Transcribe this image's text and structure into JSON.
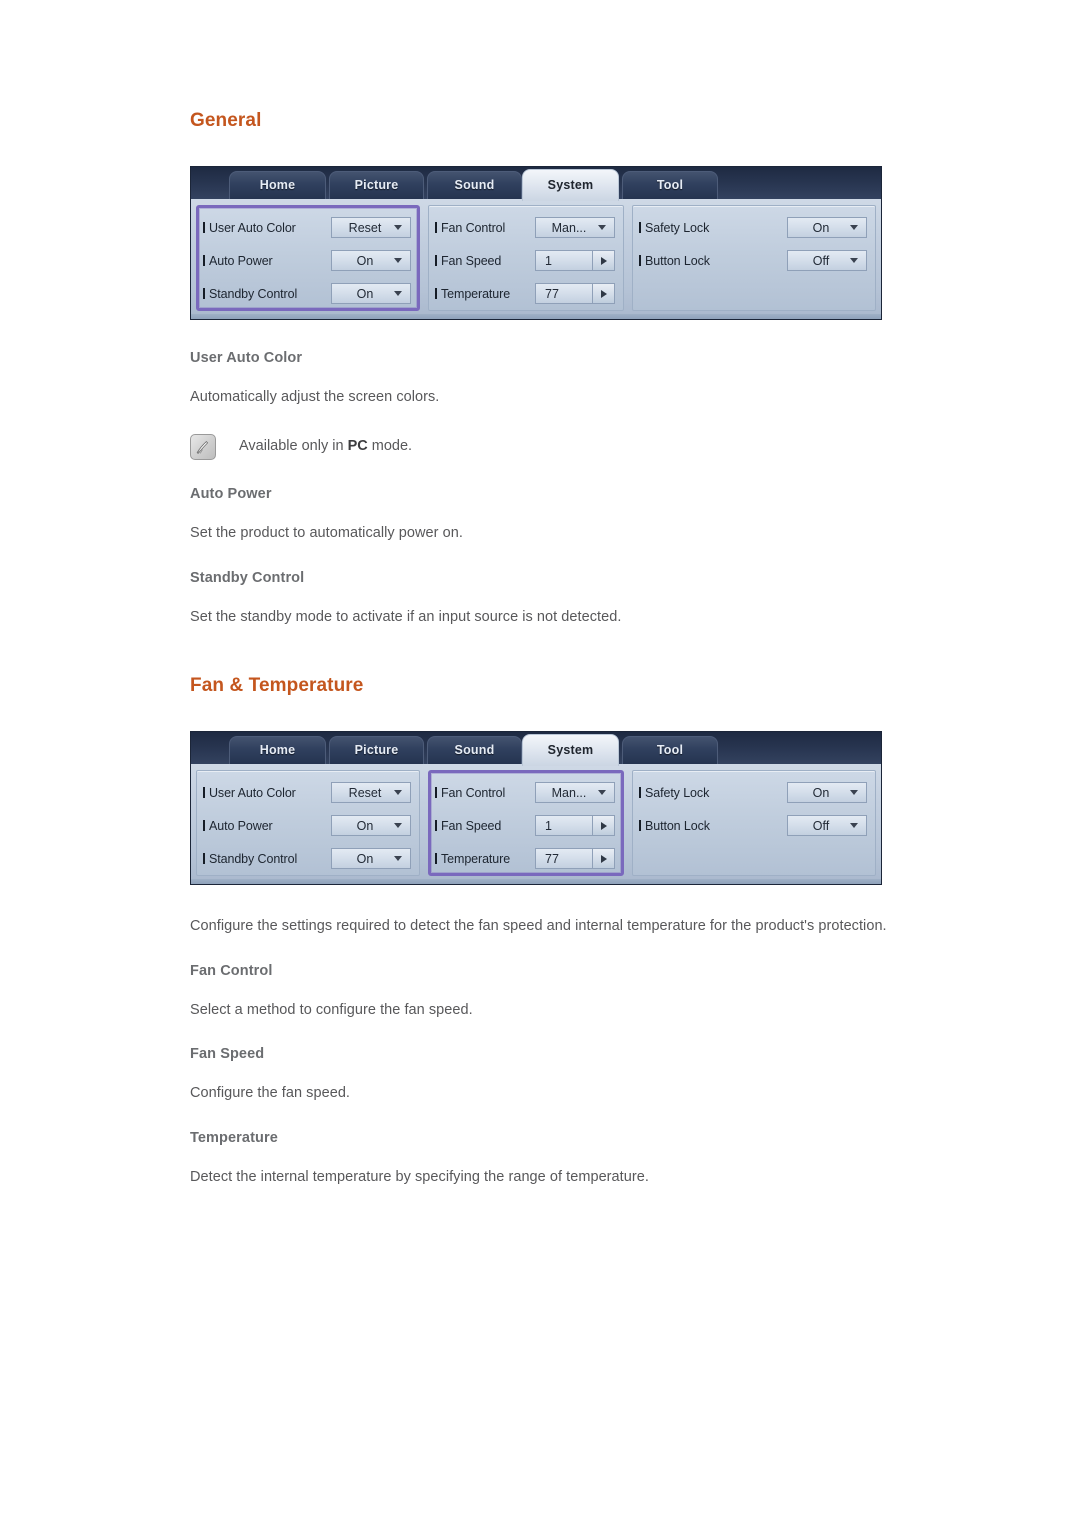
{
  "sections": [
    {
      "heading": "General",
      "osd": {
        "tabs": [
          {
            "label": "Home",
            "active": false
          },
          {
            "label": "Picture",
            "active": false
          },
          {
            "label": "Sound",
            "active": false
          },
          {
            "label": "System",
            "active": true
          },
          {
            "label": "Tool",
            "active": false
          }
        ],
        "columns": [
          {
            "highlighted": true,
            "rows": [
              {
                "label": "User Auto Color",
                "value": "Reset",
                "control": "dropdown"
              },
              {
                "label": "Auto Power",
                "value": "On",
                "control": "dropdown"
              },
              {
                "label": "Standby Control",
                "value": "On",
                "control": "dropdown"
              }
            ]
          },
          {
            "highlighted": false,
            "rows": [
              {
                "label": "Fan Control",
                "value": "Man...",
                "control": "dropdown"
              },
              {
                "label": "Fan Speed",
                "value": "1",
                "control": "spinner"
              },
              {
                "label": "Temperature",
                "value": "77",
                "control": "spinner"
              }
            ]
          },
          {
            "highlighted": false,
            "rows": [
              {
                "label": "Safety Lock",
                "value": "On",
                "control": "dropdown"
              },
              {
                "label": "Button Lock",
                "value": "Off",
                "control": "dropdown"
              }
            ]
          }
        ]
      },
      "blocks": [
        {
          "type": "sub-heading",
          "text": "User Auto Color"
        },
        {
          "type": "body",
          "text": "Automatically adjust the screen colors."
        },
        {
          "type": "note",
          "text_before": "Available only in ",
          "bold": "PC",
          "text_after": " mode.",
          "icon": "note-pencil-icon"
        },
        {
          "type": "sub-heading",
          "text": "Auto Power"
        },
        {
          "type": "body",
          "text": "Set the product to automatically power on."
        },
        {
          "type": "sub-heading",
          "text": "Standby Control"
        },
        {
          "type": "body",
          "text": "Set the standby mode to activate if an input source is not detected."
        }
      ]
    },
    {
      "heading": "Fan & Temperature",
      "osd": {
        "tabs": [
          {
            "label": "Home",
            "active": false
          },
          {
            "label": "Picture",
            "active": false
          },
          {
            "label": "Sound",
            "active": false
          },
          {
            "label": "System",
            "active": true
          },
          {
            "label": "Tool",
            "active": false
          }
        ],
        "columns": [
          {
            "highlighted": false,
            "rows": [
              {
                "label": "User Auto Color",
                "value": "Reset",
                "control": "dropdown"
              },
              {
                "label": "Auto Power",
                "value": "On",
                "control": "dropdown"
              },
              {
                "label": "Standby Control",
                "value": "On",
                "control": "dropdown"
              }
            ]
          },
          {
            "highlighted": true,
            "rows": [
              {
                "label": "Fan Control",
                "value": "Man...",
                "control": "dropdown"
              },
              {
                "label": "Fan Speed",
                "value": "1",
                "control": "spinner"
              },
              {
                "label": "Temperature",
                "value": "77",
                "control": "spinner"
              }
            ]
          },
          {
            "highlighted": false,
            "rows": [
              {
                "label": "Safety Lock",
                "value": "On",
                "control": "dropdown"
              },
              {
                "label": "Button Lock",
                "value": "Off",
                "control": "dropdown"
              }
            ]
          }
        ]
      },
      "blocks": [
        {
          "type": "body",
          "text": "Configure the settings required to detect the fan speed and internal temperature for the product's protection."
        },
        {
          "type": "sub-heading",
          "text": "Fan Control"
        },
        {
          "type": "body",
          "text": "Select a method to configure the fan speed."
        },
        {
          "type": "sub-heading",
          "text": "Fan Speed"
        },
        {
          "type": "body",
          "text": "Configure the fan speed."
        },
        {
          "type": "sub-heading",
          "text": "Temperature"
        },
        {
          "type": "body",
          "text": "Detect the internal temperature by specifying the range of temperature."
        }
      ]
    }
  ],
  "colors": {
    "heading_orange": "#c4561e",
    "sub_heading_gray": "#6b6d70",
    "body_gray": "#58585a",
    "highlight_purple": "#7a69bd",
    "osd_header_navy": "#27344f",
    "osd_panel_blue": "#c0cddd"
  }
}
